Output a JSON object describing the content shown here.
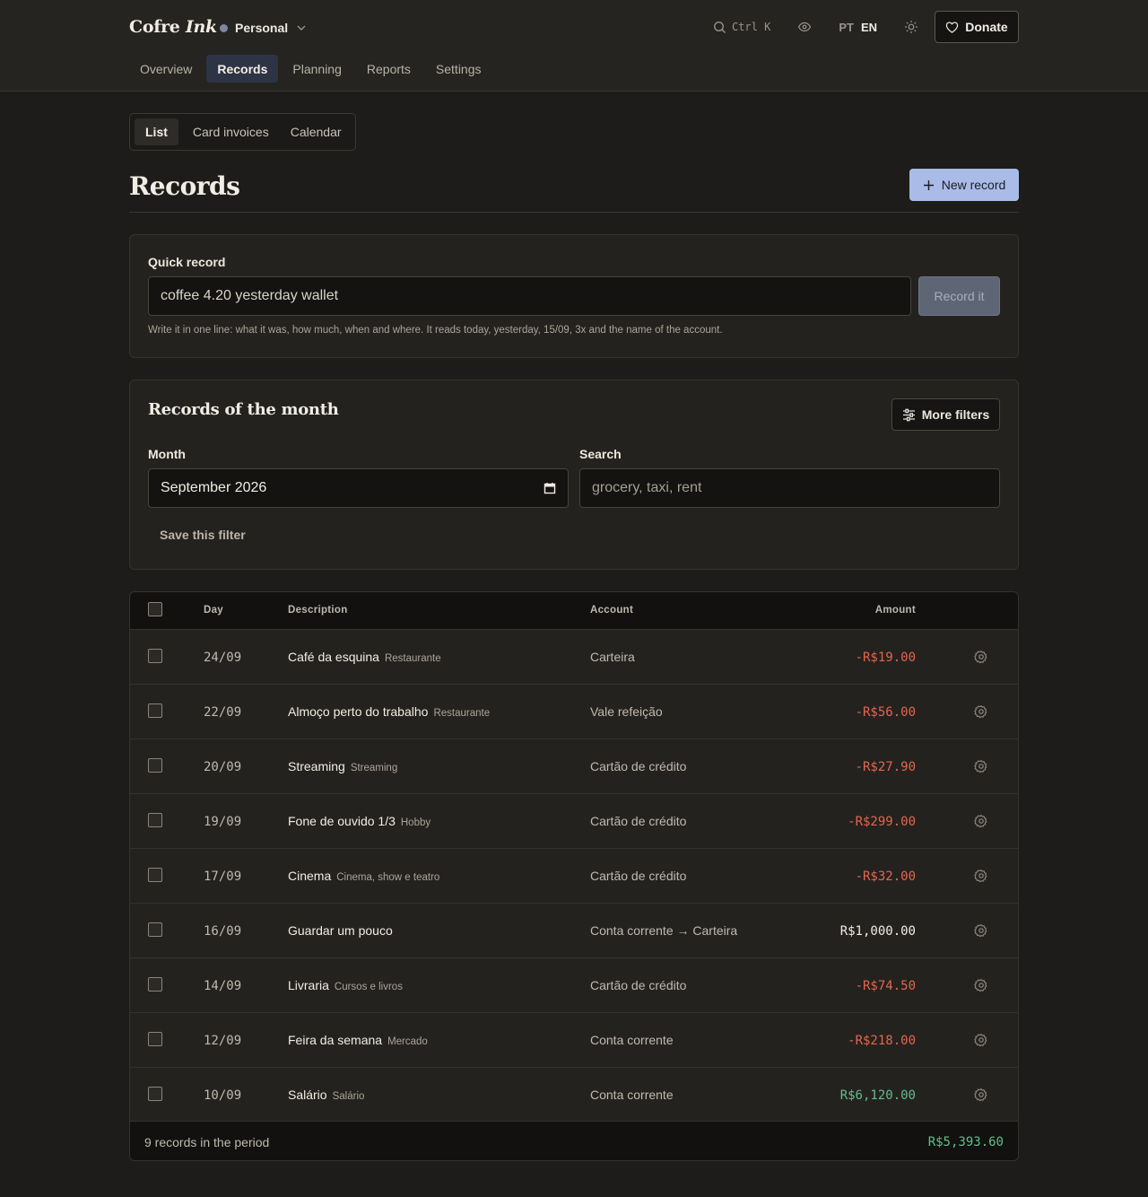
{
  "app": {
    "brand_plain": "Cofre",
    "brand_italic": "Ink",
    "workspace": "Personal",
    "shortcut": "Ctrl K",
    "lang_pt": "PT",
    "lang_en": "EN",
    "donate": "Donate"
  },
  "nav": [
    "Overview",
    "Records",
    "Planning",
    "Reports",
    "Settings"
  ],
  "subtabs": [
    "List",
    "Card invoices",
    "Calendar"
  ],
  "page": {
    "title": "Records",
    "new_record": "New record"
  },
  "quick_record": {
    "label": "Quick record",
    "value": "coffee 4.20 yesterday wallet",
    "button": "Record it",
    "help": "Write it in one line: what it was, how much, when and where. It reads today, yesterday, 15/09, 3x and the name of the account."
  },
  "month_panel": {
    "title": "Records of the month",
    "more_filters": "More filters",
    "month_label": "Month",
    "month_value": "September 2026",
    "search_label": "Search",
    "search_placeholder": "grocery, taxi, rent",
    "save_filter": "Save this filter"
  },
  "table": {
    "headers": {
      "day": "Day",
      "description": "Description",
      "account": "Account",
      "amount": "Amount"
    },
    "rows": [
      {
        "day": "24/09",
        "desc": "Café da esquina",
        "cat": "Restaurante",
        "account": "Carteira",
        "amount": "-R$19.00",
        "kind": "neg"
      },
      {
        "day": "22/09",
        "desc": "Almoço perto do trabalho",
        "cat": "Restaurante",
        "account": "Vale refeição",
        "amount": "-R$56.00",
        "kind": "neg"
      },
      {
        "day": "20/09",
        "desc": "Streaming",
        "cat": "Streaming",
        "account": "Cartão de crédito",
        "amount": "-R$27.90",
        "kind": "neg"
      },
      {
        "day": "19/09",
        "desc": "Fone de ouvido 1/3",
        "cat": "Hobby",
        "account": "Cartão de crédito",
        "amount": "-R$299.00",
        "kind": "neg"
      },
      {
        "day": "17/09",
        "desc": "Cinema",
        "cat": "Cinema, show e teatro",
        "account": "Cartão de crédito",
        "amount": "-R$32.00",
        "kind": "neg"
      },
      {
        "day": "16/09",
        "desc": "Guardar um pouco",
        "cat": "",
        "account": "Conta corrente → Carteira",
        "amount": "R$1,000.00",
        "kind": "transfer"
      },
      {
        "day": "14/09",
        "desc": "Livraria",
        "cat": "Cursos e livros",
        "account": "Cartão de crédito",
        "amount": "-R$74.50",
        "kind": "neg"
      },
      {
        "day": "12/09",
        "desc": "Feira da semana",
        "cat": "Mercado",
        "account": "Conta corrente",
        "amount": "-R$218.00",
        "kind": "neg"
      },
      {
        "day": "10/09",
        "desc": "Salário",
        "cat": "Salário",
        "account": "Conta corrente",
        "amount": "R$6,120.00",
        "kind": "pos"
      }
    ],
    "footer_count": "9 records in the period",
    "footer_total": "R$5,393.60"
  },
  "colors": {
    "accent": "#a9bbe6",
    "negative": "#e2664f",
    "positive": "#5fbf8a",
    "background": "#1d1c1a"
  }
}
